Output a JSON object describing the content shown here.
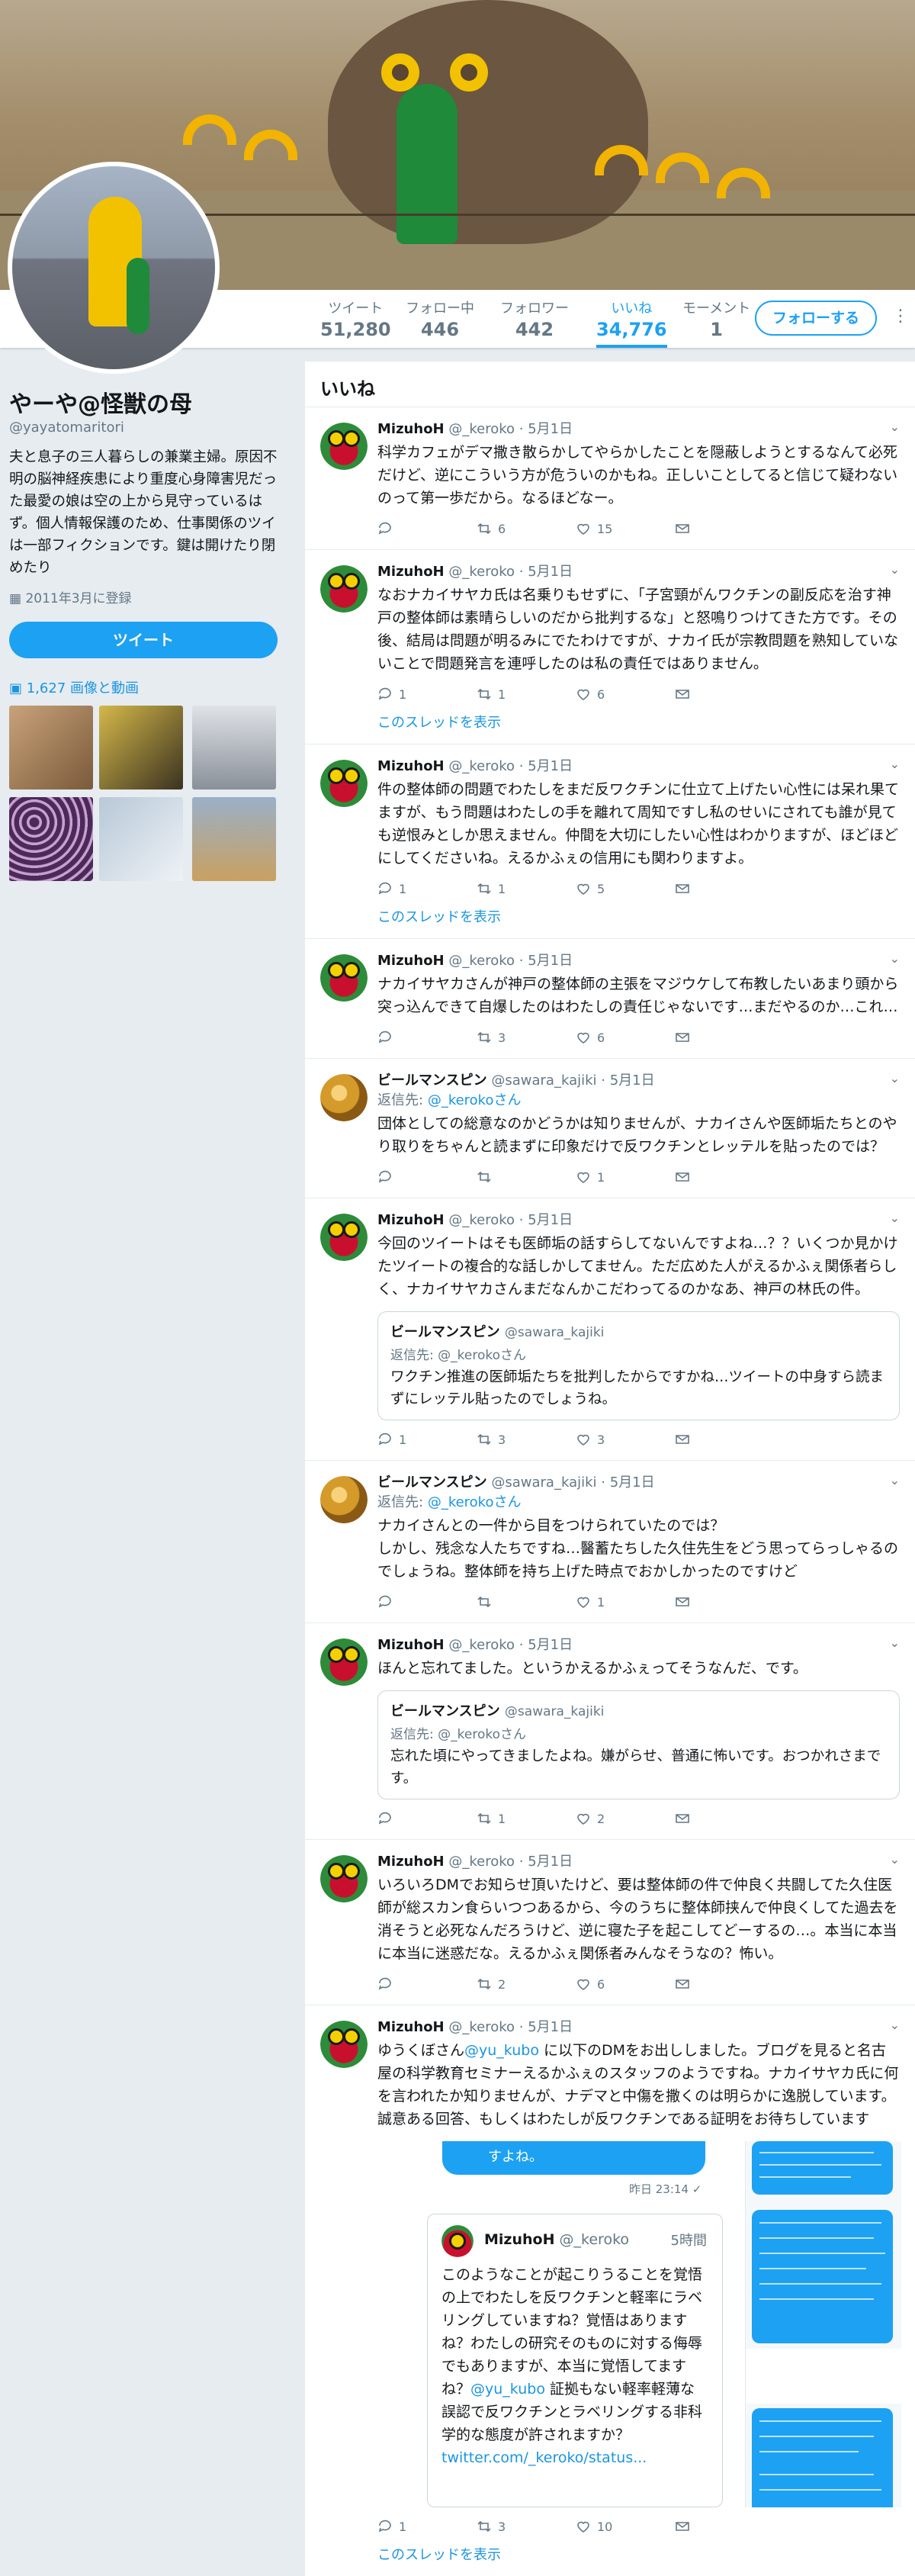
{
  "profile": {
    "name": "やーや@怪獣の母",
    "handle": "@yayatomaritori",
    "bio": "夫と息子の三人暮らしの兼業主婦。原因不明の脳神経疾患により重度心身障害児だった最愛の娘は空の上から見守っているはず。個人情報保護のため、仕事関係のツイは一部フィクションです。鍵は開けたり閉めたり",
    "joined": "2011年3月に登録",
    "tweet_button": "ツイート",
    "media_link": "1,627 画像と動画"
  },
  "stats": [
    {
      "label": "ツイート",
      "value": "51,280"
    },
    {
      "label": "フォロー中",
      "value": "446"
    },
    {
      "label": "フォロワー",
      "value": "442"
    },
    {
      "label": "いいね",
      "value": "34,776"
    },
    {
      "label": "モーメント",
      "value": "1"
    }
  ],
  "follow_button": "フォローする",
  "feed": {
    "title": "いいね",
    "thread_link": "このスレッドを表示",
    "tweets": [
      {
        "name": "MizuhoH",
        "handle": "@_keroko",
        "date": "5月1日",
        "text": "科学カフェがデマ撒き散らかしてやらかしたことを隠蔽しようとするなんて必死だけど、逆にこういう方が危ういのかもね。正しいことしてると信じて疑わないのって第一歩だから。なるほどなー。",
        "reply": "",
        "retweets": "6",
        "likes": "15"
      },
      {
        "name": "MizuhoH",
        "handle": "@_keroko",
        "date": "5月1日",
        "text": "なおナカイサヤカ氏は名乗りもせずに、「子宮頸がんワクチンの副反応を治す神戸の整体師は素晴らしいのだから批判するな」と怒鳴りつけてきた方です。その後、結局は問題が明るみにでたわけですが、ナカイ氏が宗教問題を熟知していないことで問題発言を連呼したのは私の責任ではありません。",
        "reply": "1",
        "retweets": "1",
        "likes": "6"
      },
      {
        "name": "MizuhoH",
        "handle": "@_keroko",
        "date": "5月1日",
        "text": "件の整体師の問題でわたしをまだ反ワクチンに仕立て上げたい心性には呆れ果てますが、もう問題はわたしの手を離れて周知ですし私のせいにされても誰が見ても逆恨みとしか思えません。仲間を大切にしたい心性はわかりますが、ほどほどにしてくださいね。えるかふぇの信用にも関わりますよ。",
        "reply": "1",
        "retweets": "1",
        "likes": "5"
      },
      {
        "name": "MizuhoH",
        "handle": "@_keroko",
        "date": "5月1日",
        "text": "ナカイサヤカさんが神戸の整体師の主張をマジウケして布教したいあまり頭から突っ込んできて自爆したのはわたしの責任じゃないです…まだやるのか…これ…",
        "reply": "",
        "retweets": "3",
        "likes": "6"
      },
      {
        "name": "ビールマンスピン",
        "handle": "@sawara_kajiki",
        "date": "5月1日",
        "reply_to_label": "返信先:",
        "reply_to": "@_kerokoさん",
        "text": "団体としての総意なのかどうかは知りませんが、ナカイさんや医師垢たちとのやり取りをちゃんと読まずに印象だけで反ワクチンとレッテルを貼ったのでは？",
        "reply": "",
        "retweets": "",
        "likes": "1"
      },
      {
        "name": "MizuhoH",
        "handle": "@_keroko",
        "date": "5月1日",
        "text": "今回のツイートはそも医師垢の話すらしてないんですよね…？？いくつか見かけたツイートの複合的な話しかしてません。ただ広めた人がえるかふぇ関係者らしく、ナカイサヤカさんまだなんかこだわってるのかなあ、神戸の林氏の件。",
        "quote": {
          "name": "ビールマンスピン",
          "handle": "@sawara_kajiki",
          "reply_to": "返信先: @_kerokoさん",
          "text": "ワクチン推進の医師垢たちを批判したからですかね…ツイートの中身すら読まずにレッテル貼ったのでしょうね。"
        },
        "reply": "1",
        "retweets": "3",
        "likes": "3"
      },
      {
        "name": "ビールマンスピン",
        "handle": "@sawara_kajiki",
        "date": "5月1日",
        "reply_to_label": "返信先:",
        "reply_to": "@_kerokoさん",
        "text": "ナカイさんとの一件から目をつけられていたのでは？\nしかし、残念な人たちですね…醫蓄たちした久住先生をどう思ってらっしゃるのでしょうね。整体師を持ち上げた時点でおかしかったのですけど",
        "reply": "",
        "retweets": "",
        "likes": "1"
      },
      {
        "name": "MizuhoH",
        "handle": "@_keroko",
        "date": "5月1日",
        "text": "ほんと忘れてました。というかえるかふぇってそうなんだ、です。",
        "quote": {
          "name": "ビールマンスピン",
          "handle": "@sawara_kajiki",
          "reply_to": "返信先: @_kerokoさん",
          "text": "忘れた頃にやってきましたよね。嫌がらせ、普通に怖いです。おつかれさまです。"
        },
        "reply": "",
        "retweets": "1",
        "likes": "2"
      },
      {
        "name": "MizuhoH",
        "handle": "@_keroko",
        "date": "5月1日",
        "text": "いろいろDMでお知らせ頂いたけど、要は整体師の件で仲良く共闘してた久住医師が総スカン食らいつつあるから、今のうちに整体師挟んで仲良くしてた過去を消そうと必死なんだろうけど、逆に寝た子を起こしてどーするの…。本当に本当に本当に迷惑だな。えるかふぇ関係者みんなそうなの？怖い。",
        "reply": "",
        "retweets": "2",
        "likes": "6"
      },
      {
        "name": "MizuhoH",
        "handle": "@_keroko",
        "date": "5月1日",
        "text_pre": "ゆうくぼさん",
        "text_link": "@yu_kubo",
        "text_post": " に以下のDMをお出ししました。ブログを見ると名古屋の科学教育セミナーえるかふぇのスタッフのようですね。ナカイサヤカ氏に何を言われたか知りませんが、ナデマと中傷を撒くのは明らかに逸脱しています。誠意ある回答、もしくはわたしが反ワクチンである証明をお待ちしています",
        "dm": {
          "bubble": "すよね。",
          "time": "昨日 23:14 ✓",
          "card_name": "MizuhoH",
          "card_handle": "@_keroko",
          "card_time": "5時間",
          "card_text_pre": "このようなことが起こりうることを覚悟の上でわたしを反ワクチンと軽率にラベリングしていますね？覚悟はありますね？わたしの研究そのものに対する侮辱でもありますが、本当に覚悟してますね？",
          "card_link": "@yu_kubo",
          "card_text_mid": " 証拠もない軽率軽薄な誤認で反ワクチンとラベリングする非科学的な態度が許されますか？ ",
          "card_url": "twitter.com/_keroko/status..."
        },
        "reply": "1",
        "retweets": "3",
        "likes": "10"
      }
    ]
  },
  "colors": {
    "accent": "#1da1f2",
    "link": "#1b95e0",
    "muted": "#657786",
    "background": "#e6ecf0"
  }
}
